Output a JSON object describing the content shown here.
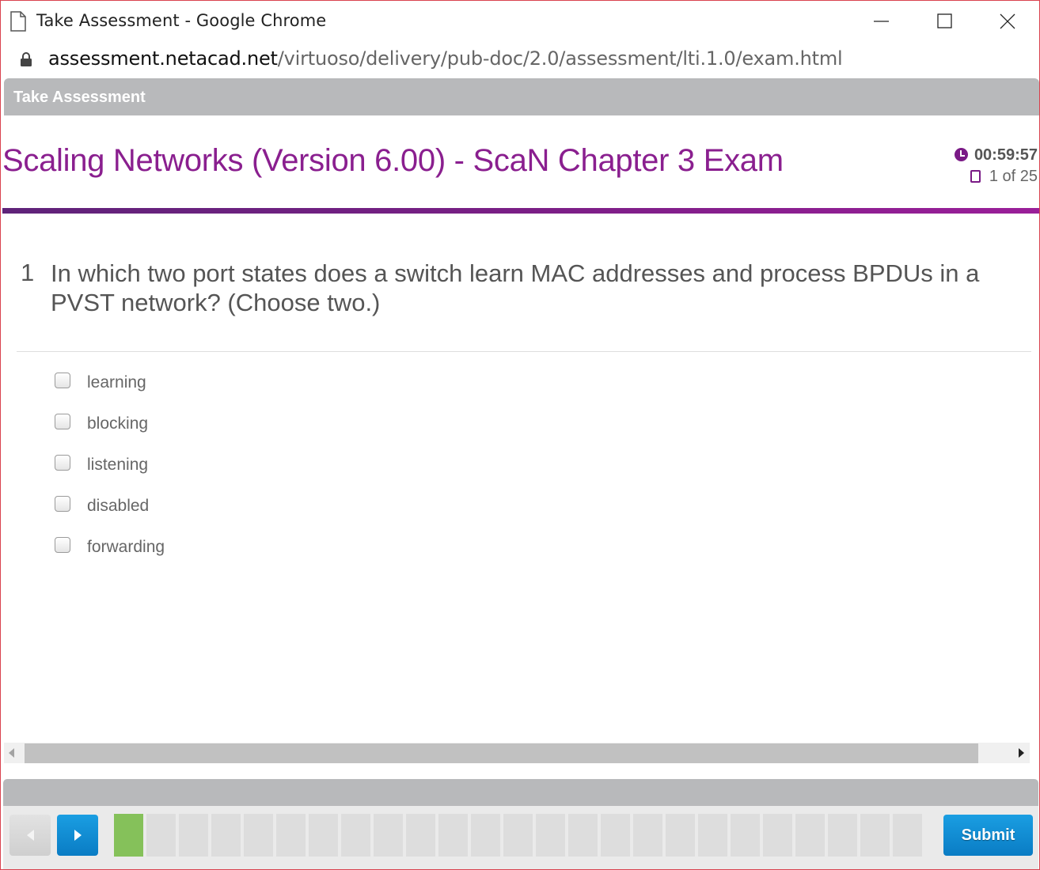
{
  "window": {
    "title": "Take Assessment - Google Chrome"
  },
  "address": {
    "host": "assessment.netacad.net",
    "path": "/virtuoso/delivery/pub-doc/2.0/assessment/lti.1.0/exam.html"
  },
  "header": {
    "label": "Take Assessment"
  },
  "exam": {
    "title": "Scaling Networks (Version 6.00) - ScaN Chapter 3 Exam",
    "timer": "00:59:57",
    "progress": "1 of 25"
  },
  "question": {
    "number": "1",
    "text": "In which two port states does a switch learn MAC addresses and process BPDUs in a PVST network? (Choose two.)",
    "options": [
      {
        "label": "learning",
        "checked": false
      },
      {
        "label": "blocking",
        "checked": false
      },
      {
        "label": "listening",
        "checked": false
      },
      {
        "label": "disabled",
        "checked": false
      },
      {
        "label": "forwarding",
        "checked": false
      }
    ]
  },
  "footer": {
    "submit_label": "Submit",
    "total_questions": 25,
    "current_question": 1
  },
  "colors": {
    "accent_purple": "#8a1f8f",
    "header_gray": "#b8b9bb",
    "nav_blue": "#0a7cc4",
    "current_green": "#85c15a"
  }
}
